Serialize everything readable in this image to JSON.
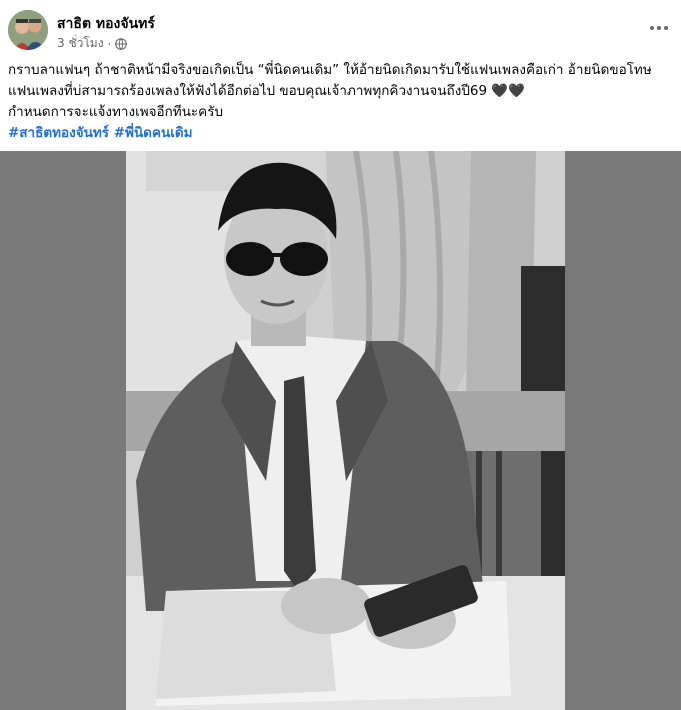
{
  "post": {
    "author": "สาธิต ทองจันทร์",
    "time": "3 ชั่วโมง",
    "privacy_icon": "globe-icon",
    "menu_icon": "more-horizontal-icon",
    "text_lines": [
      "กราบลาแฟนๆ ถ้าชาติหน้ามีจริงขอเกิดเป็น  “พี่นิดคนเดิม” ให้อ้ายนิดเกิดมารับใช้แฟนเพลงคือเก่า อ้ายนิดขอโทษ",
      "แฟนเพลงที่บ่สามารถร้องเพลงให้ฟังได้อีกต่อไป ขอบคุณเจ้าภาพทุกคิวงานจนถึงปี69 🖤🖤",
      "กำหนดการจะแจ้งทางเพจอีกทีนะครับ"
    ],
    "hashtags": [
      "#สาธิตทองจันทร์",
      "#พี่นิดคนเดิม"
    ]
  },
  "colors": {
    "link": "#216fdb",
    "meta": "#65676b",
    "media_bg": "#797979"
  }
}
